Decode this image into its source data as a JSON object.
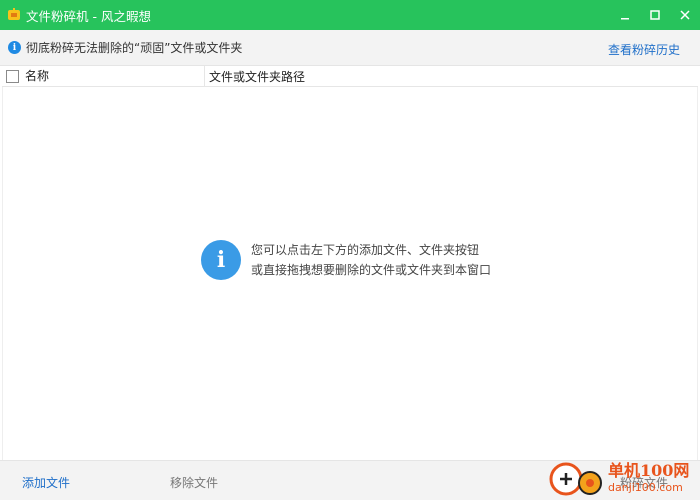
{
  "window": {
    "title": "文件粉碎机 - 风之暇想",
    "accent_color": "#27c35c",
    "controls": [
      "minimize-icon",
      "maximize-icon",
      "close-icon"
    ]
  },
  "infobar": {
    "icon": "info-icon",
    "text": "彻底粉碎无法删除的“顽固”文件或文件夹",
    "history_link": "查看粉碎历史"
  },
  "table": {
    "columns": [
      "名称",
      "文件或文件夹路径"
    ],
    "rows": []
  },
  "empty_hint": {
    "icon": "info-icon",
    "line1": "您可以点击左下方的添加文件、文件夹按钮",
    "line2": "或直接拖拽想要删除的文件或文件夹到本窗口"
  },
  "footer": {
    "add_label": "添加文件",
    "remove_label": "移除文件",
    "shred_label": "粉碎文件"
  },
  "watermark": {
    "name": "单机100网",
    "url": "danji100.com",
    "color": "#e8541c"
  }
}
